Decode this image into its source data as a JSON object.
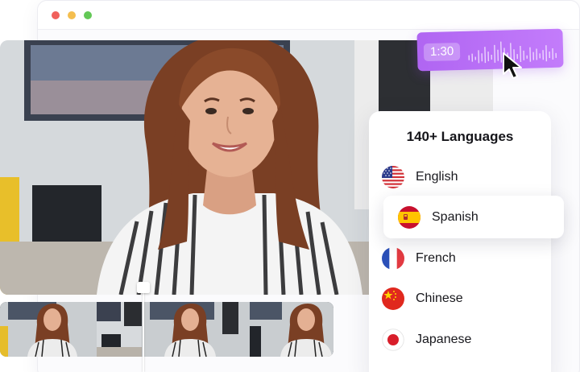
{
  "window": {
    "controls": [
      "close",
      "minimize",
      "maximize"
    ]
  },
  "audio": {
    "duration": "1:30",
    "accent_color": "#b86cf6"
  },
  "languages": {
    "title": "140+ Languages",
    "selected": "Spanish",
    "items": [
      {
        "label": "English",
        "flag": "us-flag-icon"
      },
      {
        "label": "Spanish",
        "flag": "es-flag-icon"
      },
      {
        "label": "French",
        "flag": "fr-flag-icon"
      },
      {
        "label": "Chinese",
        "flag": "cn-flag-icon"
      },
      {
        "label": "Japanese",
        "flag": "jp-flag-icon"
      }
    ]
  },
  "timeline": {
    "thumbnails": 4
  }
}
